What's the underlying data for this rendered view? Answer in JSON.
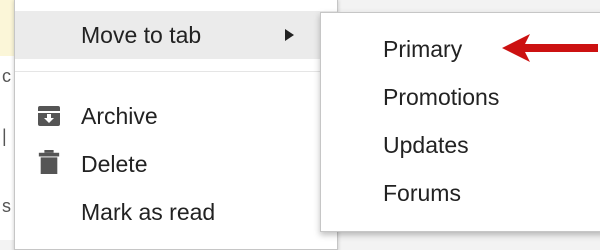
{
  "background": {
    "fragments": [
      "c",
      "|",
      "s"
    ]
  },
  "menu": {
    "move_to_tab": "Move to tab",
    "archive": "Archive",
    "delete": "Delete",
    "mark_as_read": "Mark as read"
  },
  "submenu": {
    "items": [
      "Primary",
      "Promotions",
      "Updates",
      "Forums"
    ]
  },
  "annotation": {
    "arrow_color": "#cc1111",
    "icon": "red-arrow-icon"
  },
  "colors": {
    "highlight": "#ebebeb",
    "text": "#222222",
    "icon": "#555555"
  }
}
